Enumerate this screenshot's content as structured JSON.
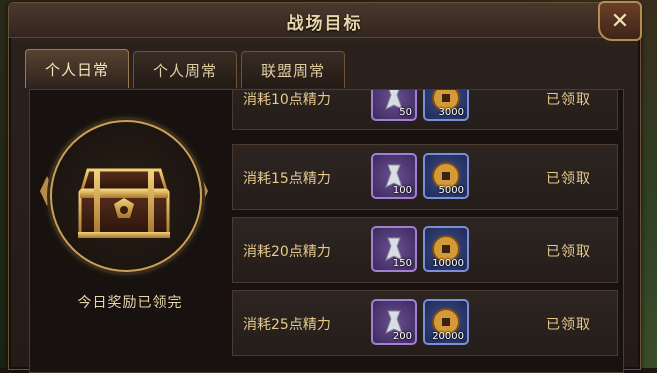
{
  "window": {
    "title": "战场目标",
    "close_label": "✕"
  },
  "tabs": [
    {
      "label": "个人日常",
      "active": true
    },
    {
      "label": "个人周常",
      "active": false
    },
    {
      "label": "联盟周常",
      "active": false
    }
  ],
  "reward_panel": {
    "status_text": "今日奖励已领完",
    "chest_icon": "treasure-chest-icon"
  },
  "tasks": [
    {
      "label": "消耗10点精力",
      "items": [
        {
          "icon": "silver-token-icon",
          "qty": "50"
        },
        {
          "icon": "copper-coin-icon",
          "qty": "3000"
        }
      ],
      "status": "已领取"
    },
    {
      "label": "消耗15点精力",
      "items": [
        {
          "icon": "silver-token-icon",
          "qty": "100"
        },
        {
          "icon": "copper-coin-icon",
          "qty": "5000"
        }
      ],
      "status": "已领取"
    },
    {
      "label": "消耗20点精力",
      "items": [
        {
          "icon": "silver-token-icon",
          "qty": "150"
        },
        {
          "icon": "copper-coin-icon",
          "qty": "10000"
        }
      ],
      "status": "已领取"
    },
    {
      "label": "消耗25点精力",
      "items": [
        {
          "icon": "silver-token-icon",
          "qty": "200"
        },
        {
          "icon": "copper-coin-icon",
          "qty": "20000"
        }
      ],
      "status": "已领取"
    }
  ],
  "colors": {
    "accent_gold": "#e6c98c",
    "purple_item": "#a37fd2",
    "blue_item": "#7a8fd6"
  }
}
